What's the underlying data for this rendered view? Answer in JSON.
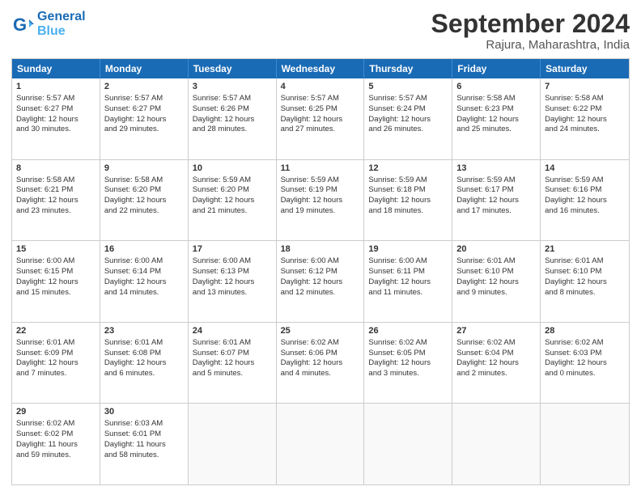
{
  "logo": {
    "line1": "General",
    "line2": "Blue"
  },
  "title": "September 2024",
  "subtitle": "Rajura, Maharashtra, India",
  "header_days": [
    "Sunday",
    "Monday",
    "Tuesday",
    "Wednesday",
    "Thursday",
    "Friday",
    "Saturday"
  ],
  "weeks": [
    [
      {
        "day": "1",
        "lines": [
          "Sunrise: 5:57 AM",
          "Sunset: 6:27 PM",
          "Daylight: 12 hours",
          "and 30 minutes."
        ]
      },
      {
        "day": "2",
        "lines": [
          "Sunrise: 5:57 AM",
          "Sunset: 6:27 PM",
          "Daylight: 12 hours",
          "and 29 minutes."
        ]
      },
      {
        "day": "3",
        "lines": [
          "Sunrise: 5:57 AM",
          "Sunset: 6:26 PM",
          "Daylight: 12 hours",
          "and 28 minutes."
        ]
      },
      {
        "day": "4",
        "lines": [
          "Sunrise: 5:57 AM",
          "Sunset: 6:25 PM",
          "Daylight: 12 hours",
          "and 27 minutes."
        ]
      },
      {
        "day": "5",
        "lines": [
          "Sunrise: 5:57 AM",
          "Sunset: 6:24 PM",
          "Daylight: 12 hours",
          "and 26 minutes."
        ]
      },
      {
        "day": "6",
        "lines": [
          "Sunrise: 5:58 AM",
          "Sunset: 6:23 PM",
          "Daylight: 12 hours",
          "and 25 minutes."
        ]
      },
      {
        "day": "7",
        "lines": [
          "Sunrise: 5:58 AM",
          "Sunset: 6:22 PM",
          "Daylight: 12 hours",
          "and 24 minutes."
        ]
      }
    ],
    [
      {
        "day": "8",
        "lines": [
          "Sunrise: 5:58 AM",
          "Sunset: 6:21 PM",
          "Daylight: 12 hours",
          "and 23 minutes."
        ]
      },
      {
        "day": "9",
        "lines": [
          "Sunrise: 5:58 AM",
          "Sunset: 6:20 PM",
          "Daylight: 12 hours",
          "and 22 minutes."
        ]
      },
      {
        "day": "10",
        "lines": [
          "Sunrise: 5:59 AM",
          "Sunset: 6:20 PM",
          "Daylight: 12 hours",
          "and 21 minutes."
        ]
      },
      {
        "day": "11",
        "lines": [
          "Sunrise: 5:59 AM",
          "Sunset: 6:19 PM",
          "Daylight: 12 hours",
          "and 19 minutes."
        ]
      },
      {
        "day": "12",
        "lines": [
          "Sunrise: 5:59 AM",
          "Sunset: 6:18 PM",
          "Daylight: 12 hours",
          "and 18 minutes."
        ]
      },
      {
        "day": "13",
        "lines": [
          "Sunrise: 5:59 AM",
          "Sunset: 6:17 PM",
          "Daylight: 12 hours",
          "and 17 minutes."
        ]
      },
      {
        "day": "14",
        "lines": [
          "Sunrise: 5:59 AM",
          "Sunset: 6:16 PM",
          "Daylight: 12 hours",
          "and 16 minutes."
        ]
      }
    ],
    [
      {
        "day": "15",
        "lines": [
          "Sunrise: 6:00 AM",
          "Sunset: 6:15 PM",
          "Daylight: 12 hours",
          "and 15 minutes."
        ]
      },
      {
        "day": "16",
        "lines": [
          "Sunrise: 6:00 AM",
          "Sunset: 6:14 PM",
          "Daylight: 12 hours",
          "and 14 minutes."
        ]
      },
      {
        "day": "17",
        "lines": [
          "Sunrise: 6:00 AM",
          "Sunset: 6:13 PM",
          "Daylight: 12 hours",
          "and 13 minutes."
        ]
      },
      {
        "day": "18",
        "lines": [
          "Sunrise: 6:00 AM",
          "Sunset: 6:12 PM",
          "Daylight: 12 hours",
          "and 12 minutes."
        ]
      },
      {
        "day": "19",
        "lines": [
          "Sunrise: 6:00 AM",
          "Sunset: 6:11 PM",
          "Daylight: 12 hours",
          "and 11 minutes."
        ]
      },
      {
        "day": "20",
        "lines": [
          "Sunrise: 6:01 AM",
          "Sunset: 6:10 PM",
          "Daylight: 12 hours",
          "and 9 minutes."
        ]
      },
      {
        "day": "21",
        "lines": [
          "Sunrise: 6:01 AM",
          "Sunset: 6:10 PM",
          "Daylight: 12 hours",
          "and 8 minutes."
        ]
      }
    ],
    [
      {
        "day": "22",
        "lines": [
          "Sunrise: 6:01 AM",
          "Sunset: 6:09 PM",
          "Daylight: 12 hours",
          "and 7 minutes."
        ]
      },
      {
        "day": "23",
        "lines": [
          "Sunrise: 6:01 AM",
          "Sunset: 6:08 PM",
          "Daylight: 12 hours",
          "and 6 minutes."
        ]
      },
      {
        "day": "24",
        "lines": [
          "Sunrise: 6:01 AM",
          "Sunset: 6:07 PM",
          "Daylight: 12 hours",
          "and 5 minutes."
        ]
      },
      {
        "day": "25",
        "lines": [
          "Sunrise: 6:02 AM",
          "Sunset: 6:06 PM",
          "Daylight: 12 hours",
          "and 4 minutes."
        ]
      },
      {
        "day": "26",
        "lines": [
          "Sunrise: 6:02 AM",
          "Sunset: 6:05 PM",
          "Daylight: 12 hours",
          "and 3 minutes."
        ]
      },
      {
        "day": "27",
        "lines": [
          "Sunrise: 6:02 AM",
          "Sunset: 6:04 PM",
          "Daylight: 12 hours",
          "and 2 minutes."
        ]
      },
      {
        "day": "28",
        "lines": [
          "Sunrise: 6:02 AM",
          "Sunset: 6:03 PM",
          "Daylight: 12 hours",
          "and 0 minutes."
        ]
      }
    ],
    [
      {
        "day": "29",
        "lines": [
          "Sunrise: 6:02 AM",
          "Sunset: 6:02 PM",
          "Daylight: 11 hours",
          "and 59 minutes."
        ]
      },
      {
        "day": "30",
        "lines": [
          "Sunrise: 6:03 AM",
          "Sunset: 6:01 PM",
          "Daylight: 11 hours",
          "and 58 minutes."
        ]
      },
      null,
      null,
      null,
      null,
      null
    ]
  ]
}
